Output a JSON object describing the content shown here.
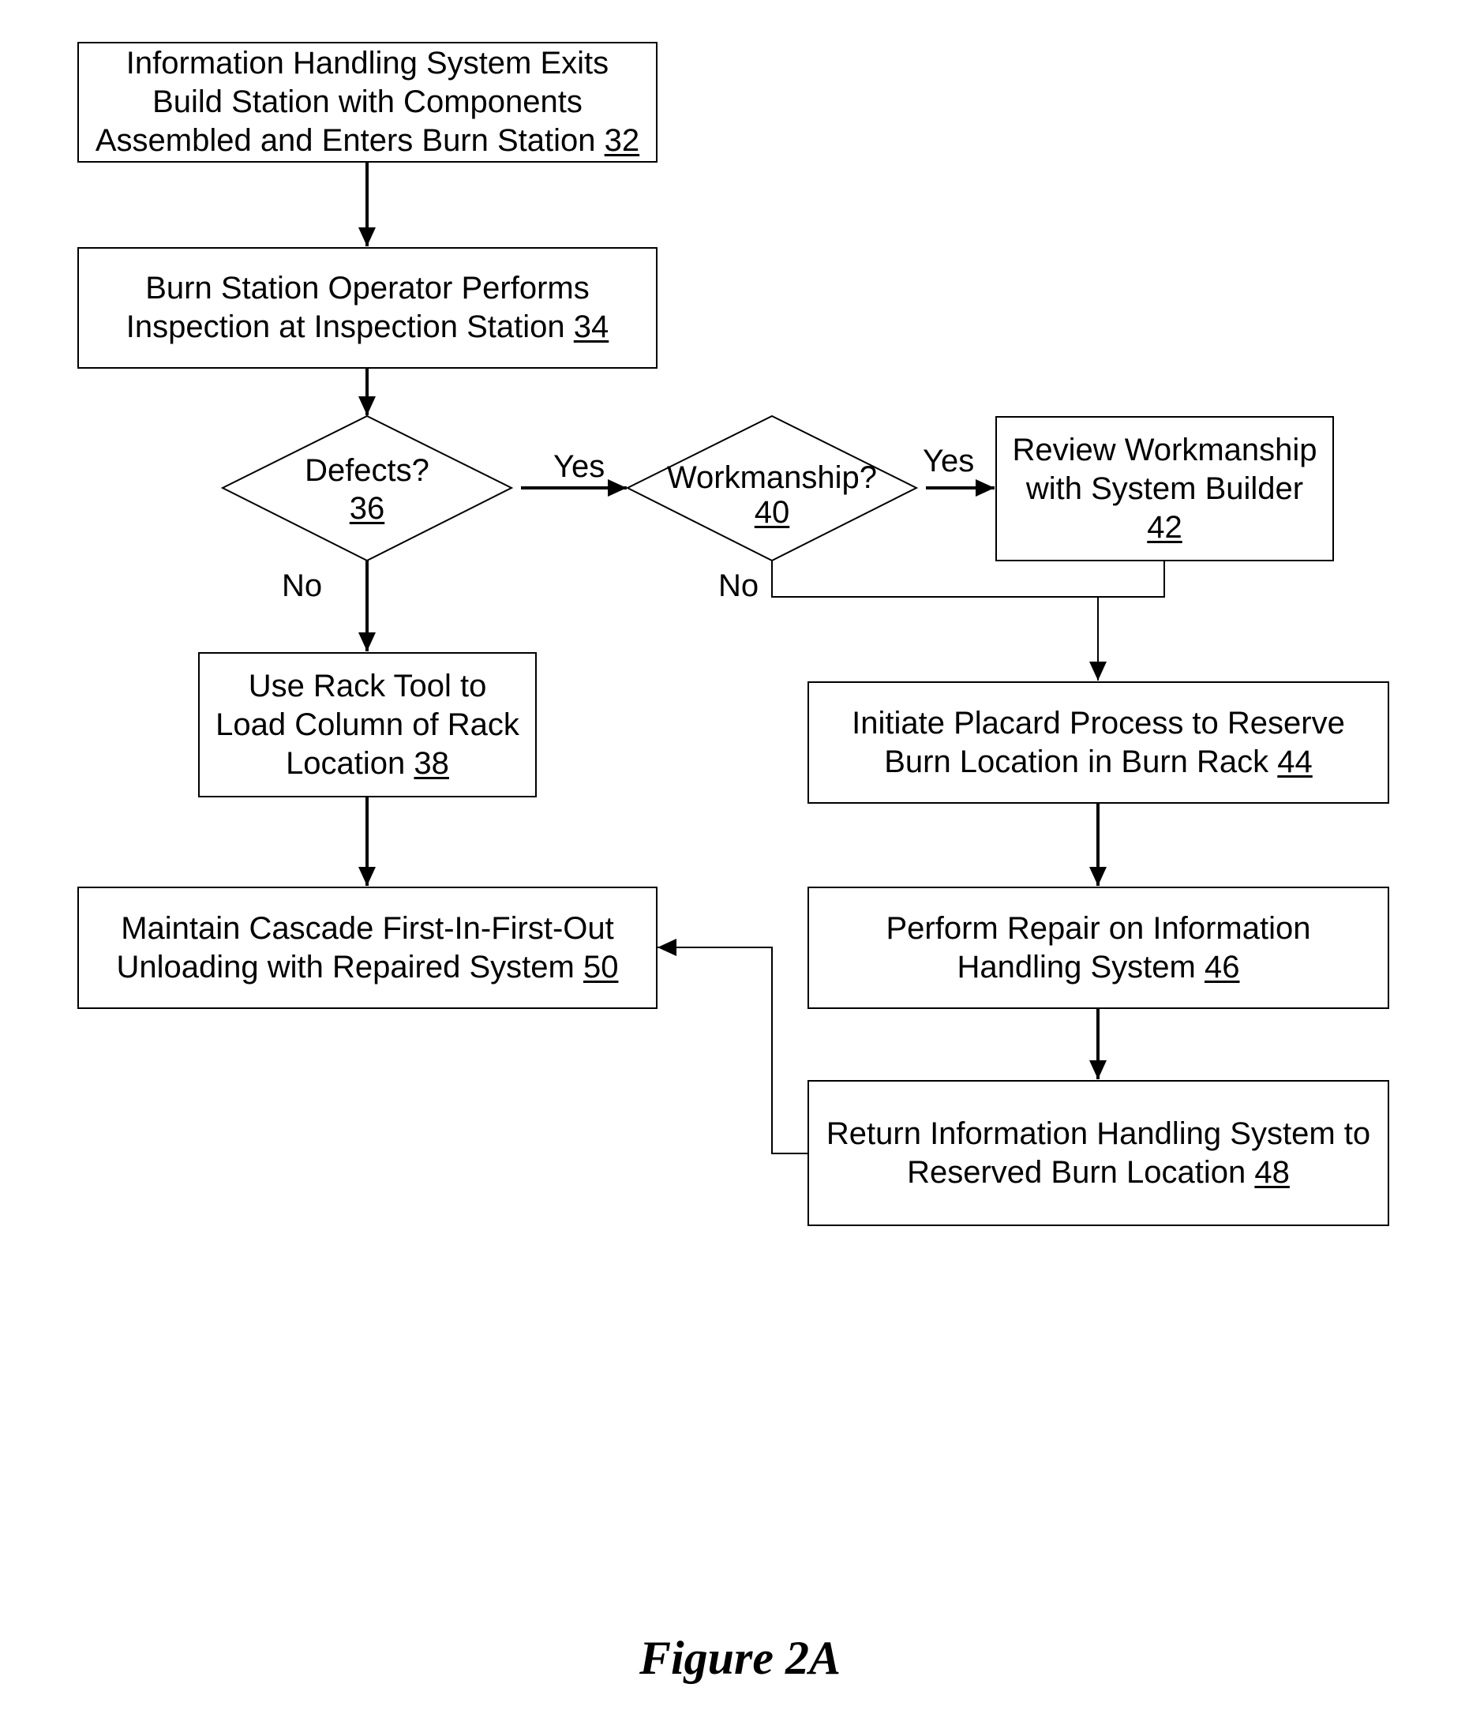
{
  "figure": {
    "caption": "Figure 2A"
  },
  "nodes": {
    "n32": {
      "lines": [
        "Information Handling System Exits",
        "Build Station with Components",
        "Assembled and Enters Burn Station"
      ],
      "ref": "32"
    },
    "n34": {
      "lines": [
        "Burn Station Operator Performs",
        "Inspection at Inspection Station"
      ],
      "ref": "34"
    },
    "n36": {
      "lines": [
        "Defects?"
      ],
      "ref": "36"
    },
    "n38": {
      "lines": [
        "Use Rack Tool to",
        "Load Column of Rack",
        "Location"
      ],
      "ref": "38"
    },
    "n40": {
      "lines": [
        "Workmanship?"
      ],
      "ref": "40"
    },
    "n42": {
      "lines": [
        "Review Workmanship",
        "with System Builder"
      ],
      "ref": "42"
    },
    "n44": {
      "lines": [
        "Initiate Placard Process to Reserve",
        "Burn Location in Burn Rack"
      ],
      "ref": "44"
    },
    "n46": {
      "lines": [
        "Perform Repair on Information",
        "Handling System"
      ],
      "ref": "46"
    },
    "n48": {
      "lines": [
        "Return Information Handling System to",
        "Reserved Burn Location"
      ],
      "ref": "48"
    },
    "n50": {
      "lines": [
        "Maintain Cascade First-In-First-Out",
        "Unloading with Repaired System"
      ],
      "ref": "50"
    }
  },
  "edge_labels": {
    "defects_yes": "Yes",
    "defects_no": "No",
    "workmanship_yes": "Yes",
    "workmanship_no": "No"
  },
  "colors": {
    "stroke": "#000000",
    "background": "#ffffff"
  }
}
